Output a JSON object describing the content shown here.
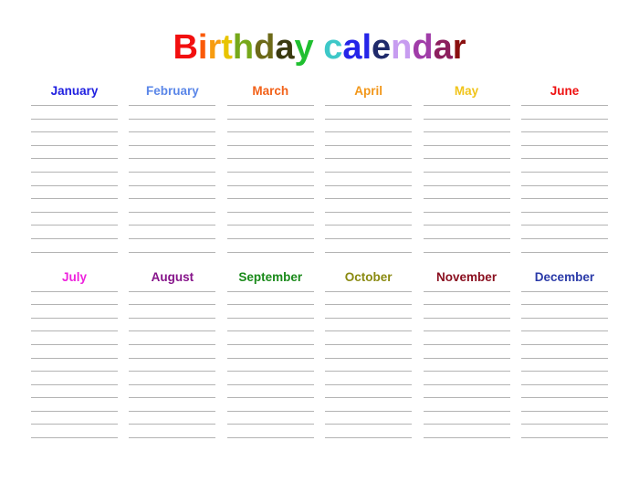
{
  "page": {
    "background": "#ffffff",
    "line_color": "#b3b3b3",
    "lines_per_month": 12
  },
  "title": {
    "text": "Birthday calendar",
    "letters": [
      {
        "char": "B",
        "color": "#f20f0f"
      },
      {
        "char": "i",
        "color": "#fa5a08"
      },
      {
        "char": "r",
        "color": "#f79c10"
      },
      {
        "char": "t",
        "color": "#e8c400"
      },
      {
        "char": "h",
        "color": "#76a81a"
      },
      {
        "char": "d",
        "color": "#6d6a18"
      },
      {
        "char": "a",
        "color": "#3a3a10"
      },
      {
        "char": "y",
        "color": "#1fbf2f"
      },
      {
        "char": " ",
        "color": "#ffffff"
      },
      {
        "char": "c",
        "color": "#3dc8c8"
      },
      {
        "char": "a",
        "color": "#2525e8"
      },
      {
        "char": "l",
        "color": "#2525e8"
      },
      {
        "char": "e",
        "color": "#1f2a6b"
      },
      {
        "char": "n",
        "color": "#c79cf0"
      },
      {
        "char": "d",
        "color": "#a03ca8"
      },
      {
        "char": "a",
        "color": "#8c1f5e"
      },
      {
        "char": "r",
        "color": "#8a0f0f"
      }
    ]
  },
  "months": [
    {
      "label": "January",
      "color": "#2020e0"
    },
    {
      "label": "February",
      "color": "#5a86e8"
    },
    {
      "label": "March",
      "color": "#f2621a"
    },
    {
      "label": "April",
      "color": "#f2971a"
    },
    {
      "label": "May",
      "color": "#f0c41a"
    },
    {
      "label": "June",
      "color": "#ee1111"
    },
    {
      "label": "July",
      "color": "#ee22dd"
    },
    {
      "label": "August",
      "color": "#86148a"
    },
    {
      "label": "September",
      "color": "#1a8a1a"
    },
    {
      "label": "October",
      "color": "#8a8a11"
    },
    {
      "label": "November",
      "color": "#8a1020"
    },
    {
      "label": "December",
      "color": "#2a3aa8"
    }
  ]
}
